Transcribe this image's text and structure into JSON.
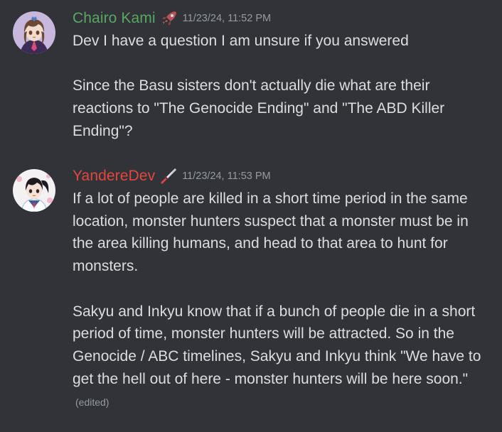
{
  "messages": [
    {
      "username": "Chairo Kami",
      "role_icon": "rocket-icon",
      "timestamp": "11/23/24, 11:52 PM",
      "paragraphs": [
        "Dev I have a question I am unsure if you answered",
        "Since the Basu sisters don't actually die what are their reactions to \"The Genocide Ending\" and \"The ABD Killer Ending\"?"
      ],
      "edited": ""
    },
    {
      "username": "YandereDev",
      "role_icon": "knife-icon",
      "timestamp": "11/23/24, 11:53 PM",
      "paragraphs": [
        "If a lot of people are killed in a short time period in the same location, monster hunters suspect that a monster must be in the area killing humans, and head to that area to hunt for monsters.",
        "Sakyu and Inkyu know that if a bunch of people die in a short period of time, monster hunters will be attracted. So in the Genocide / ABC timelines, Sakyu and Inkyu think \"We have to get the hell out of here - monster hunters will be here soon.\""
      ],
      "edited": "(edited)"
    }
  ],
  "colors": {
    "background": "#313338",
    "chairo_name": "#58a863",
    "yandere_name": "#e2473c",
    "message_text": "#dbdee1",
    "muted_text": "#949ba4"
  }
}
